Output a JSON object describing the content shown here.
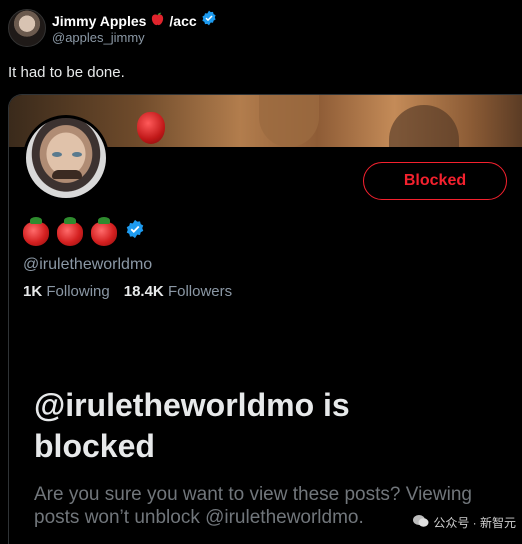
{
  "tweet": {
    "author_name": "Jimmy Apples",
    "author_suffix": "/acc",
    "author_handle": "@apples_jimmy",
    "text": "It had to be done."
  },
  "embedded_profile": {
    "block_button_label": "Blocked",
    "handle": "@irule​theworldmo",
    "following_count": "1K",
    "following_label": "Following",
    "followers_count": "18.4K",
    "followers_label": "Followers",
    "blocked_heading": "@iruletheworldmo is blocked",
    "blocked_description": "Are you sure you want to view these posts? Viewing posts won’t unblock @iruletheworldmo."
  },
  "watermark": {
    "text": "公众号 · 新智元"
  },
  "colors": {
    "background": "#000000",
    "accent_red": "#f4212e",
    "verified_blue": "#1d9bf0",
    "secondary_text": "#71767b"
  },
  "icons": [
    "apple-icon",
    "verified-badge-icon",
    "strawberry-icon",
    "wechat-icon"
  ]
}
